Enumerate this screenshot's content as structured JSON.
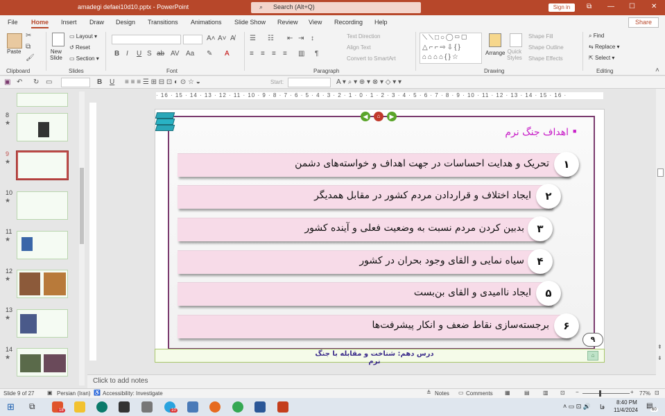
{
  "app": {
    "title": "amadegi defaei10d10.pptx - PowerPoint",
    "search_placeholder": "Search (Alt+Q)",
    "sign_in": "Sign in",
    "share": "Share"
  },
  "window_controls": {
    "ribbon_display": "⧉",
    "minimize": "—",
    "maximize": "☐",
    "close": "✕"
  },
  "tabs": [
    "File",
    "Home",
    "Insert",
    "Draw",
    "Design",
    "Transitions",
    "Animations",
    "Slide Show",
    "Review",
    "View",
    "Recording",
    "Help"
  ],
  "ribbon": {
    "clipboard": {
      "label": "Clipboard",
      "paste": "Paste"
    },
    "slides": {
      "label": "Slides",
      "new_slide": "New\nSlide",
      "layout": "Layout",
      "reset": "Reset",
      "section": "Section"
    },
    "font": {
      "label": "Font"
    },
    "paragraph": {
      "label": "Paragraph",
      "text_direction": "Text Direction",
      "align_text": "Align Text",
      "convert_smartart": "Convert to SmartArt"
    },
    "drawing": {
      "label": "Drawing",
      "arrange": "Arrange",
      "quick_styles": "Quick\nStyles",
      "shape_fill": "Shape Fill",
      "shape_outline": "Shape Outline",
      "shape_effects": "Shape Effects"
    },
    "editing": {
      "label": "Editing",
      "find": "Find",
      "replace": "Replace",
      "select": "Select"
    }
  },
  "qat": {
    "start_label": "Start:"
  },
  "ruler_text": "· 16 · 15 · 14 · 13 · 12 · 11 · 10 · 9 · 8 · 7 · 6 · 5 · 4 · 3 · 2 · 1 · 0 · 1 · 2 · 3 · 4 · 5 · 6 · 7 · 8 · 9 · 10 · 11 · 12 · 13 · 14 · 15 · 16 ·",
  "thumbnails": [
    {
      "num": "8",
      "star": "★"
    },
    {
      "num": "9",
      "star": "★"
    },
    {
      "num": "10",
      "star": "★"
    },
    {
      "num": "11",
      "star": "★"
    },
    {
      "num": "12",
      "star": "★"
    },
    {
      "num": "13",
      "star": "★"
    },
    {
      "num": "14",
      "star": "★"
    }
  ],
  "slide": {
    "title": "اهداف جنگ نرم",
    "bullet": "■",
    "rows": [
      {
        "num": "۱",
        "text": "تحریک و هدایت احساسات در جهت اهداف و خواسته‌های دشمن"
      },
      {
        "num": "۲",
        "text": "ایجاد اختلاف و قراردادن مردم کشور در مقابل همدیگر"
      },
      {
        "num": "۳",
        "text": "بدبین کردن مردم نسبت به وضعیت فعلی و آینده کشور"
      },
      {
        "num": "۴",
        "text": "سیاه نمایی و القای وجود بحران در کشور"
      },
      {
        "num": "۵",
        "text": "ایجاد ناامیدی و القای بن‌بست"
      },
      {
        "num": "۶",
        "text": "برجسته‌سازی نقاط ضعف و انکار پیشرفت‌ها"
      }
    ],
    "page_badge": "۹",
    "footer": "درس دهم: شناخت و مقابله با جنگ نرم"
  },
  "notes_placeholder": "Click to add notes",
  "status": {
    "slide_count": "Slide 9 of 27",
    "language": "Persian (Iran)",
    "accessibility": "Accessibility: Investigate",
    "notes": "Notes",
    "comments": "Comments",
    "zoom": "77%"
  },
  "taskbar": {
    "time": "8:40 PM",
    "date": "11/4/2024",
    "lang": "فا",
    "notif": "60",
    "badge1": "18",
    "badge2": "10"
  }
}
